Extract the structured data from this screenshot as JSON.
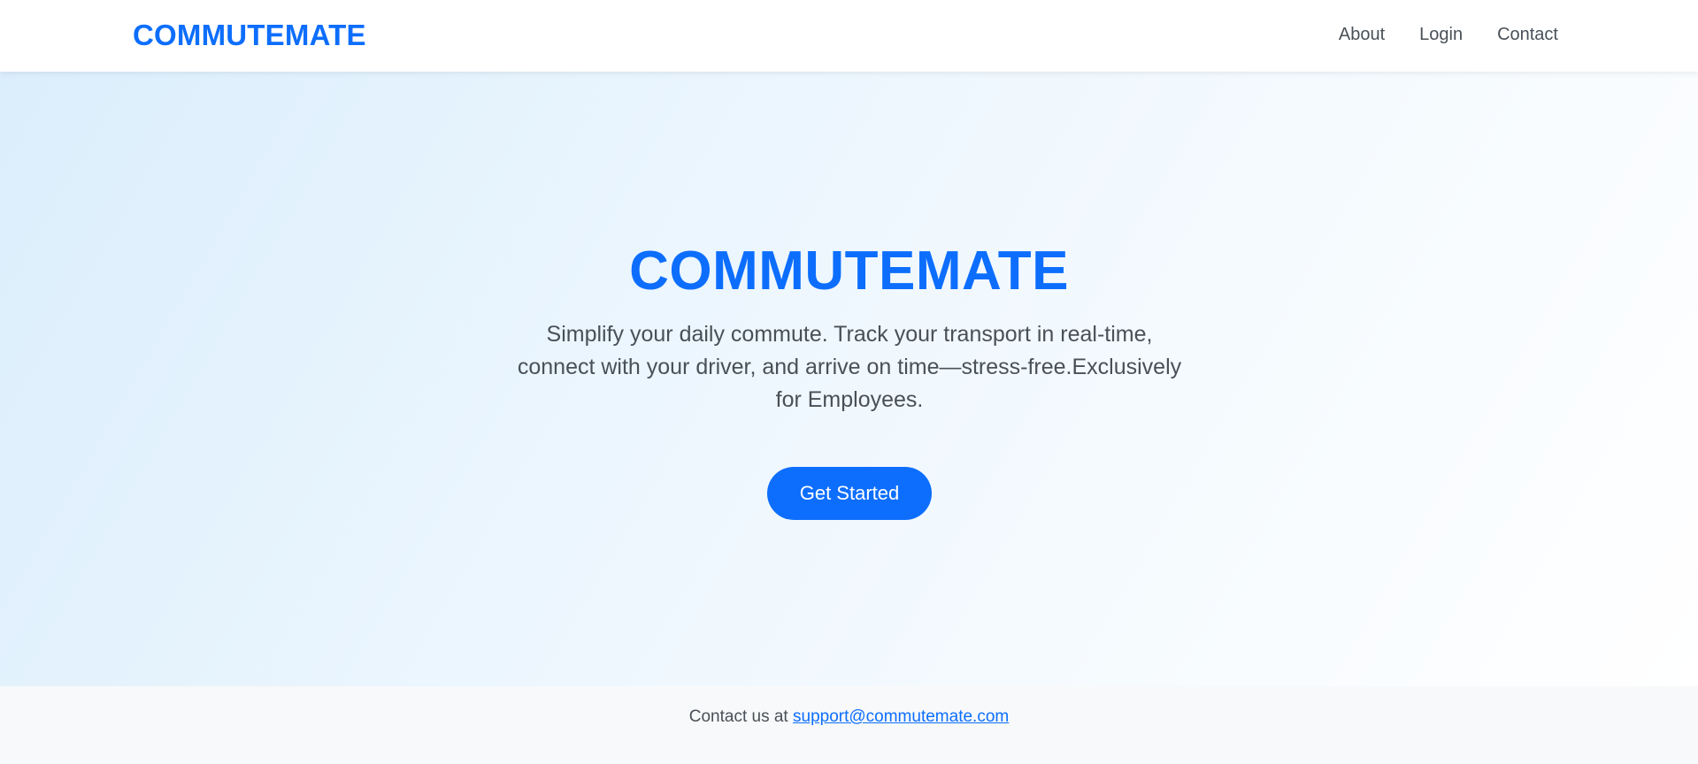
{
  "header": {
    "brand": "COMMUTEMATE",
    "nav": {
      "about": "About",
      "login": "Login",
      "contact": "Contact"
    }
  },
  "hero": {
    "title": "COMMUTEMATE",
    "description": "Simplify your daily commute. Track your transport in real-time, connect with your driver, and arrive on time—stress-free.Exclusively for Employees.",
    "cta_label": "Get Started"
  },
  "footer": {
    "prefix": "Contact us at ",
    "email": "support@commutemate.com"
  },
  "colors": {
    "accent": "#0d6efd",
    "text": "#495057",
    "footer_bg": "#f8f9fa"
  }
}
